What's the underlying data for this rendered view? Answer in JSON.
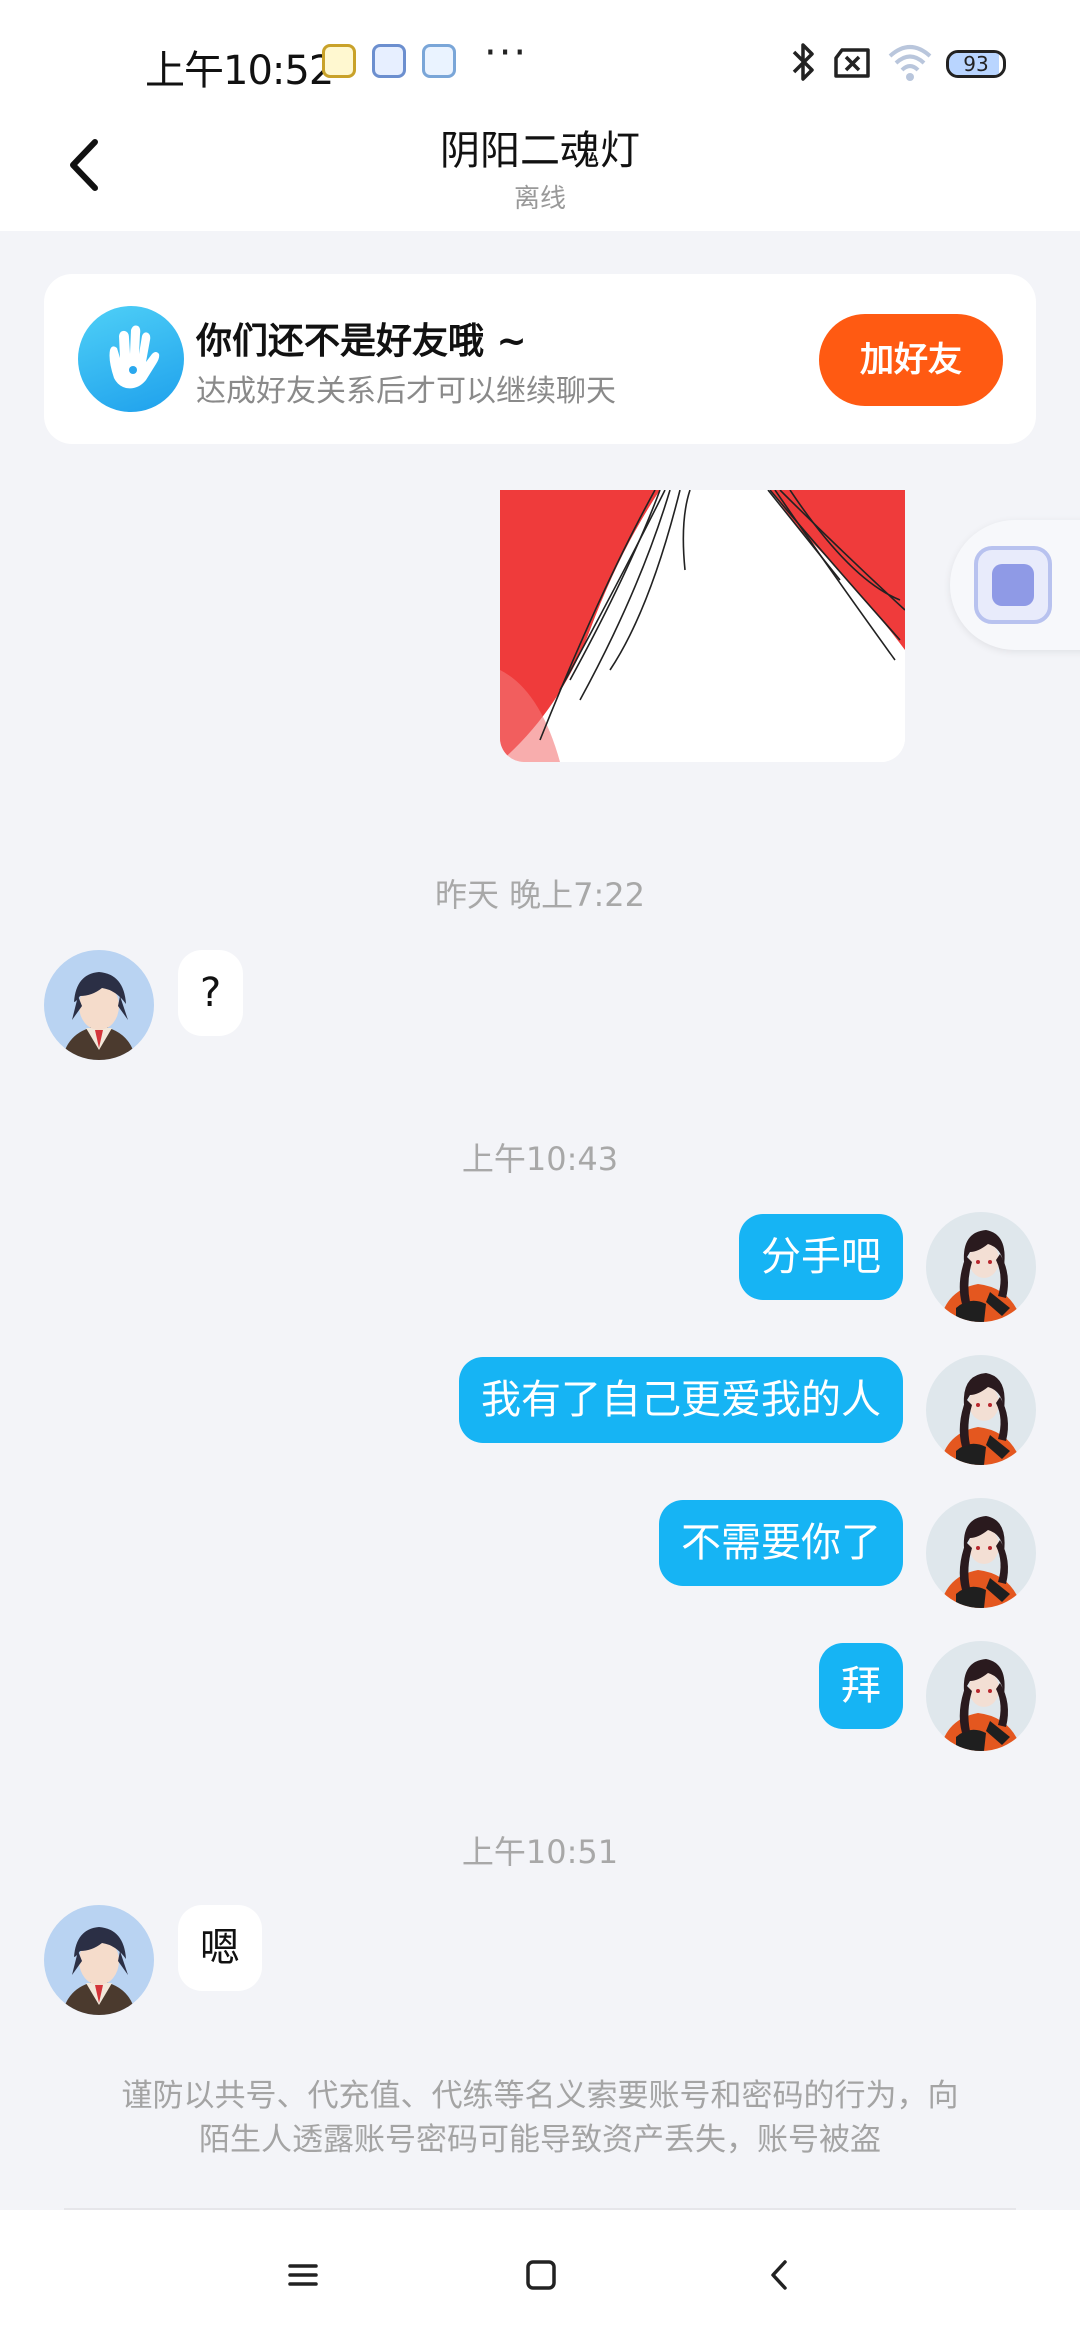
{
  "status_bar": {
    "time": "上午10:52",
    "more": "···",
    "battery": "93",
    "battery_level": 0.93
  },
  "header": {
    "title": "阴阳二魂灯",
    "subtitle": "离线"
  },
  "friend_banner": {
    "title": "你们还不是好友哦 ~",
    "description": "达成好友关系后才可以继续聊天",
    "button_label": "加好友"
  },
  "messages": [
    {
      "type": "timestamp",
      "text": "昨天 晚上7:22"
    },
    {
      "type": "incoming",
      "text": "?"
    },
    {
      "type": "timestamp",
      "text": "上午10:43"
    },
    {
      "type": "outgoing",
      "text": "分手吧"
    },
    {
      "type": "outgoing",
      "text": "我有了自己更爱我的人"
    },
    {
      "type": "outgoing",
      "text": "不需要你了"
    },
    {
      "type": "outgoing",
      "text": "拜"
    },
    {
      "type": "timestamp",
      "text": "上午10:51"
    },
    {
      "type": "incoming",
      "text": "嗯"
    }
  ],
  "footer": {
    "warning_line1": "谨防以共号、代充值、代练等名义索要账号和密码的行为，向",
    "warning_line2": "陌生人透露账号密码可能导致资产丢失，账号被盗"
  },
  "colors": {
    "outgoing_bubble": "#16b4f4",
    "add_friend_button": "#ff5a12",
    "background": "#f3f4f8"
  },
  "icons": {
    "back": "chevron-left-icon",
    "bluetooth": "bluetooth-icon",
    "sim": "no-sim-icon",
    "wifi": "wifi-icon",
    "menu": "menu-icon",
    "home": "home-square-icon",
    "nav_back": "nav-back-icon"
  }
}
